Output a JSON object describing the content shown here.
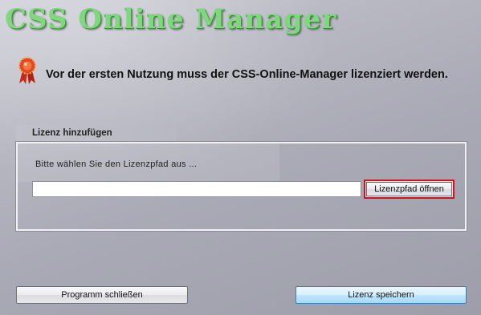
{
  "app": {
    "title": "CSS Online Manager"
  },
  "notice": {
    "icon": "award-ribbon-icon",
    "text": "Vor der ersten Nutzung muss der CSS-Online-Manager lizenziert werden."
  },
  "license_group": {
    "label": "Lizenz hinzufügen",
    "instruction": "Bitte wählen Sie den Lizenzpfad aus ...",
    "path_value": "",
    "open_button_label": "Lizenzpfad öffnen"
  },
  "footer": {
    "close_label": "Programm schließen",
    "save_label": "Lizenz speichern"
  },
  "colors": {
    "title_green": "#7fd87d",
    "focus_border_red": "#d8101a",
    "default_button_blue": "#3c7fb1"
  }
}
